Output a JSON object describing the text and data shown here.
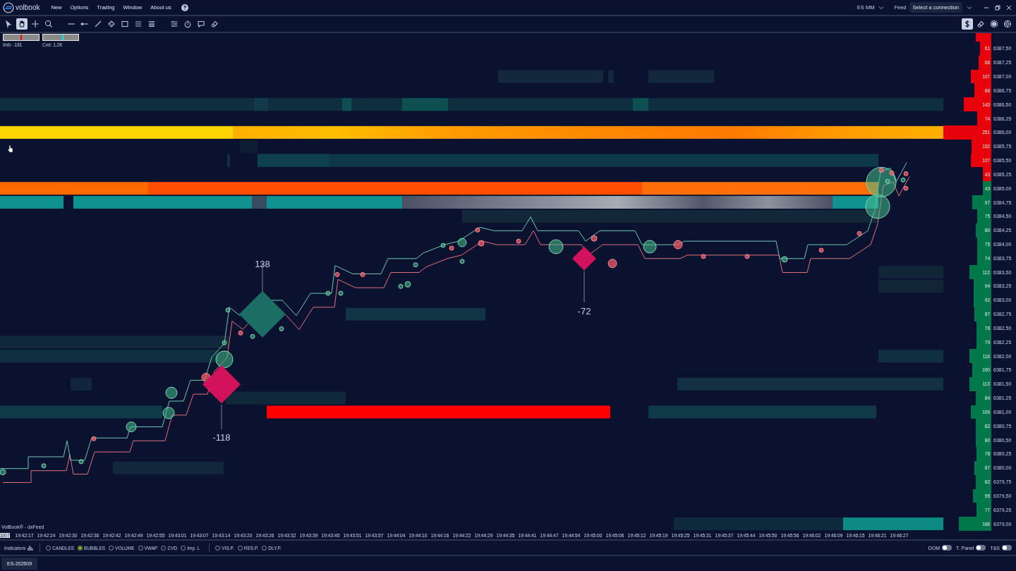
{
  "menu": {
    "logo": "volbook",
    "items": [
      "New",
      "Options",
      "Trading",
      "Window",
      "About us"
    ]
  },
  "header_right": {
    "instrument": "ES MM",
    "feed_label": "Feed",
    "connection_button": "Select a connection"
  },
  "toolbar": {
    "tools": [
      {
        "kind": "pointer",
        "selected": false
      },
      {
        "kind": "hand",
        "selected": true
      },
      {
        "kind": "crosshair",
        "selected": false
      },
      {
        "kind": "zoom",
        "selected": false
      },
      {
        "kind": "hline",
        "selected": false
      },
      {
        "kind": "ray",
        "selected": false
      },
      {
        "kind": "trendline",
        "selected": false
      },
      {
        "kind": "ruler",
        "selected": false
      },
      {
        "kind": "rectangle",
        "selected": false
      },
      {
        "kind": "lines",
        "selected": false
      },
      {
        "kind": "denselines",
        "selected": false
      },
      {
        "kind": "sliders",
        "selected": false
      },
      {
        "kind": "timer",
        "selected": false
      },
      {
        "kind": "comment",
        "selected": false
      },
      {
        "kind": "eraser",
        "selected": false
      }
    ],
    "right_tools": [
      {
        "kind": "dollar",
        "selected": true
      },
      {
        "kind": "eraser",
        "selected": false
      },
      {
        "kind": "record",
        "selected": false
      },
      {
        "kind": "gear",
        "selected": false
      }
    ]
  },
  "gauges": [
    {
      "label": "Imb: -181",
      "level": 0.48,
      "color": "#ff0000"
    },
    {
      "label": "Cvd: 1,2K",
      "level": 0.54,
      "color": "#00e5ff"
    }
  ],
  "trade_markers": [
    {
      "label": "138",
      "kind": "buy"
    },
    {
      "label": "-118",
      "kind": "sell"
    },
    {
      "label": "-72",
      "kind": "sell"
    }
  ],
  "source_label": "VolBook® - dxFeed",
  "price_ladder": [
    {
      "price": "6387,50",
      "volume": "61",
      "kind": "ask",
      "level": 0.24
    },
    {
      "price": "6387,25",
      "volume": "68",
      "kind": "ask",
      "level": 0.27
    },
    {
      "price": "6387,00",
      "volume": "107",
      "kind": "ask",
      "level": 0.43
    },
    {
      "price": "6386,75",
      "volume": "88",
      "kind": "ask",
      "level": 0.35
    },
    {
      "price": "6386,50",
      "volume": "143",
      "kind": "ask",
      "level": 0.57
    },
    {
      "price": "6386,25",
      "volume": "74",
      "kind": "ask",
      "level": 0.29
    },
    {
      "price": "6386,00",
      "volume": "251",
      "kind": "ask",
      "level": 1
    },
    {
      "price": "6385,75",
      "volume": "102",
      "kind": "ask",
      "level": 0.41
    },
    {
      "price": "6385,50",
      "volume": "107",
      "kind": "ask",
      "level": 0.43
    },
    {
      "price": "6385,25",
      "volume": "43",
      "kind": "ask",
      "level": 0.17
    },
    {
      "price": "6385,00",
      "volume": "43",
      "kind": "bid",
      "level": 0.17
    },
    {
      "price": "6384,75",
      "volume": "97",
      "kind": "bid",
      "level": 0.39
    },
    {
      "price": "6384,50",
      "volume": "75",
      "kind": "bid",
      "level": 0.3
    },
    {
      "price": "6384,25",
      "volume": "80",
      "kind": "bid",
      "level": 0.32
    },
    {
      "price": "6384,00",
      "volume": "75",
      "kind": "bid",
      "level": 0.3
    },
    {
      "price": "6383,75",
      "volume": "74",
      "kind": "bid",
      "level": 0.29
    },
    {
      "price": "6383,50",
      "volume": "112",
      "kind": "bid",
      "level": 0.45
    },
    {
      "price": "6383,25",
      "volume": "94",
      "kind": "bid",
      "level": 0.37
    },
    {
      "price": "6383,00",
      "volume": "92",
      "kind": "bid",
      "level": 0.37
    },
    {
      "price": "6382,75",
      "volume": "87",
      "kind": "bid",
      "level": 0.35
    },
    {
      "price": "6382,50",
      "volume": "78",
      "kind": "bid",
      "level": 0.31
    },
    {
      "price": "6382,25",
      "volume": "79",
      "kind": "bid",
      "level": 0.31
    },
    {
      "price": "6382,00",
      "volume": "116",
      "kind": "bid",
      "level": 0.46
    },
    {
      "price": "6381,75",
      "volume": "100",
      "kind": "bid",
      "level": 0.4
    },
    {
      "price": "6381,50",
      "volume": "113",
      "kind": "bid",
      "level": 0.45
    },
    {
      "price": "6381,25",
      "volume": "84",
      "kind": "bid",
      "level": 0.33
    },
    {
      "price": "6381,00",
      "volume": "109",
      "kind": "bid",
      "level": 0.43
    },
    {
      "price": "6380,75",
      "volume": "82",
      "kind": "bid",
      "level": 0.33
    },
    {
      "price": "6380,50",
      "volume": "80",
      "kind": "bid",
      "level": 0.32
    },
    {
      "price": "6380,25",
      "volume": "78",
      "kind": "bid",
      "level": 0.31
    },
    {
      "price": "6380,00",
      "volume": "87",
      "kind": "bid",
      "level": 0.35
    },
    {
      "price": "6379,75",
      "volume": "82",
      "kind": "bid",
      "level": 0.33
    },
    {
      "price": "6379,50",
      "volume": "95",
      "kind": "bid",
      "level": 0.38
    },
    {
      "price": "6379,25",
      "volume": "77",
      "kind": "bid",
      "level": 0.31
    },
    {
      "price": "6379,00",
      "volume": "168",
      "kind": "bid",
      "level": 0.67
    }
  ],
  "time_axis": {
    "date": "3/07",
    "times": [
      "19:42:17",
      "19:42:24",
      "19:42:30",
      "19:42:36",
      "19:42:42",
      "19:42:49",
      "19:42:55",
      "19:43:01",
      "19:43:07",
      "19:43:14",
      "19:43:20",
      "19:43:26",
      "19:43:32",
      "19:43:39",
      "19:43:45",
      "19:43:51",
      "19:43:57",
      "19:44:04",
      "19:44:10",
      "19:44:16",
      "19:44:22",
      "19:44:29",
      "19:44:35",
      "19:44:41",
      "19:44:47",
      "19:44:54",
      "19:45:00",
      "19:45:06",
      "19:45:12",
      "19:45:19",
      "19:45:25",
      "19:45:31",
      "19:45:37",
      "19:45:44",
      "19:45:50",
      "19:45:56",
      "19:46:02",
      "19:46:09",
      "19:46:15",
      "19:46:21",
      "19:46:27"
    ]
  },
  "indicators": {
    "label": "Indicators",
    "options": [
      {
        "label": "CANDLES",
        "selected": false
      },
      {
        "label": "BUBBLES",
        "selected": true
      },
      {
        "label": "VOLUME",
        "selected": false
      },
      {
        "label": "VWAP",
        "selected": false
      },
      {
        "label": "CVD",
        "selected": false
      },
      {
        "label": "Imp. L",
        "selected": false
      }
    ],
    "profiles": [
      {
        "label": "VIS.P.",
        "selected": false
      },
      {
        "label": "RES.P.",
        "selected": false
      },
      {
        "label": "DLY.P.",
        "selected": false
      }
    ]
  },
  "panels": [
    {
      "label": "DOM",
      "on": false
    },
    {
      "label": "T. Panel",
      "on": false
    },
    {
      "label": "T&S",
      "on": false
    }
  ],
  "tabs": [
    {
      "label": "ES-202509",
      "selected": true
    }
  ]
}
